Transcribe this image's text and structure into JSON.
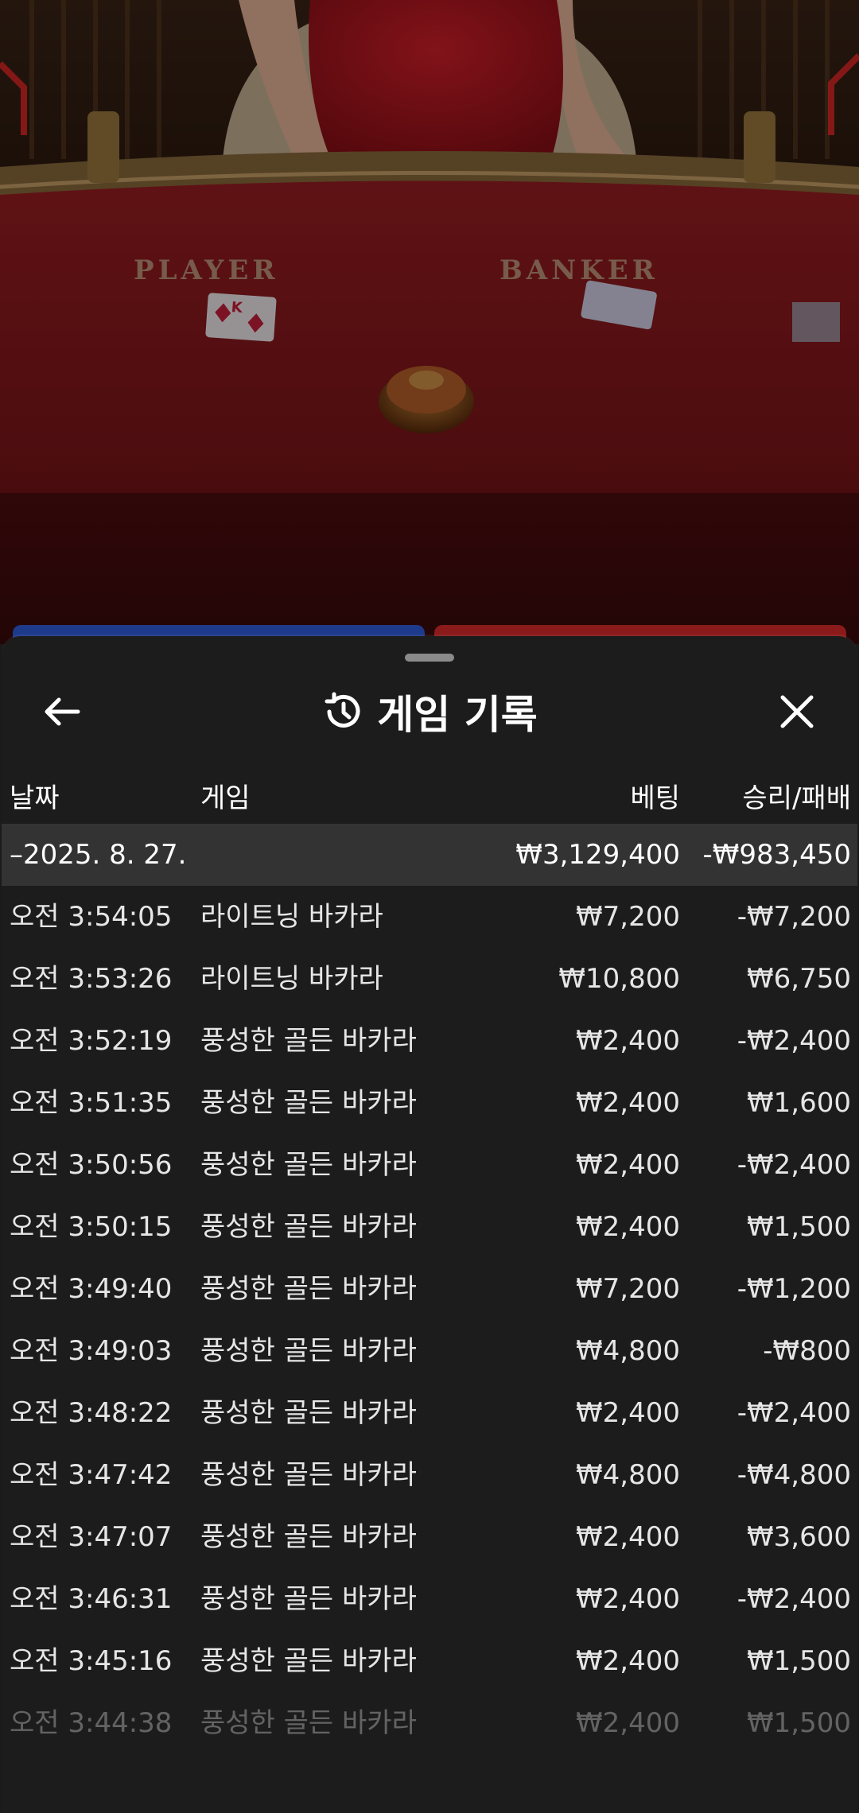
{
  "colors": {
    "felt": "#8e1a1e",
    "sheet_bg": "#1c1c1c",
    "group_bg": "#333333",
    "player_accent": "#1e3a8a",
    "banker_accent": "#8b1a1a"
  },
  "video": {
    "player_label": "PLAYER",
    "banker_label": "BANKER"
  },
  "sheet": {
    "back_icon": "arrow-left-icon",
    "history_icon": "history-clock-icon",
    "title": "게임 기록",
    "close_icon": "close-icon"
  },
  "table": {
    "headers": {
      "date": "날짜",
      "game": "게임",
      "bet": "베팅",
      "win_loss": "승리/패배"
    },
    "group": {
      "label": "–2025. 8. 27.",
      "bet_total": "₩3,129,400",
      "win_loss_total": "-₩983,450"
    },
    "rows": [
      {
        "time": "오전 3:54:05",
        "game": "라이트닝 바카라",
        "bet": "₩7,200",
        "result": "-₩7,200"
      },
      {
        "time": "오전 3:53:26",
        "game": "라이트닝 바카라",
        "bet": "₩10,800",
        "result": "₩6,750"
      },
      {
        "time": "오전 3:52:19",
        "game": "풍성한 골든 바카라",
        "bet": "₩2,400",
        "result": "-₩2,400"
      },
      {
        "time": "오전 3:51:35",
        "game": "풍성한 골든 바카라",
        "bet": "₩2,400",
        "result": "₩1,600"
      },
      {
        "time": "오전 3:50:56",
        "game": "풍성한 골든 바카라",
        "bet": "₩2,400",
        "result": "-₩2,400"
      },
      {
        "time": "오전 3:50:15",
        "game": "풍성한 골든 바카라",
        "bet": "₩2,400",
        "result": "₩1,500"
      },
      {
        "time": "오전 3:49:40",
        "game": "풍성한 골든 바카라",
        "bet": "₩7,200",
        "result": "-₩1,200"
      },
      {
        "time": "오전 3:49:03",
        "game": "풍성한 골든 바카라",
        "bet": "₩4,800",
        "result": "-₩800"
      },
      {
        "time": "오전 3:48:22",
        "game": "풍성한 골든 바카라",
        "bet": "₩2,400",
        "result": "-₩2,400"
      },
      {
        "time": "오전 3:47:42",
        "game": "풍성한 골든 바카라",
        "bet": "₩4,800",
        "result": "-₩4,800"
      },
      {
        "time": "오전 3:47:07",
        "game": "풍성한 골든 바카라",
        "bet": "₩2,400",
        "result": "₩3,600"
      },
      {
        "time": "오전 3:46:31",
        "game": "풍성한 골든 바카라",
        "bet": "₩2,400",
        "result": "-₩2,400"
      },
      {
        "time": "오전 3:45:16",
        "game": "풍성한 골든 바카라",
        "bet": "₩2,400",
        "result": "₩1,500"
      },
      {
        "time": "오전 3:44:38",
        "game": "풍성한 골든 바카라",
        "bet": "₩2,400",
        "result": "₩1,500"
      }
    ]
  }
}
